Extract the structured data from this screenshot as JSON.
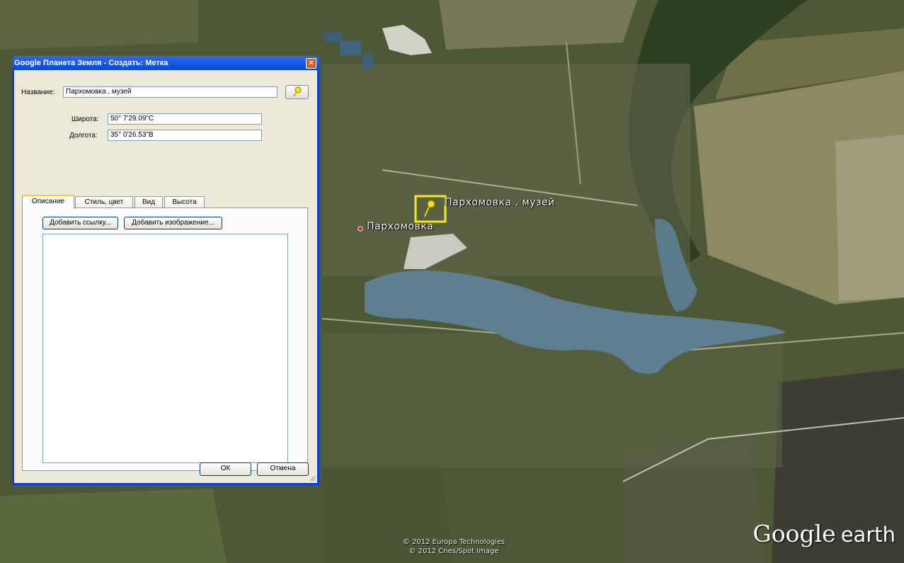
{
  "window": {
    "title": "Google Планета Земля - Создать: Метка"
  },
  "form": {
    "name_label": "Название:",
    "name_value": "Пархомовка , музей",
    "latitude_label": "Широта:",
    "latitude_value": "50° 7'29.09\"С",
    "longitude_label": "Долгота:",
    "longitude_value": "35° 0'26.53\"В"
  },
  "tabs": [
    {
      "label": "Описание",
      "active": true
    },
    {
      "label": "Стиль, цвет"
    },
    {
      "label": "Вид"
    },
    {
      "label": "Высота"
    }
  ],
  "description": {
    "add_link_label": "Добавить ссылку...",
    "add_image_label": "Добавить изображение...",
    "text": ""
  },
  "footer": {
    "ok_label": "ОК",
    "cancel_label": "Отмена"
  },
  "map": {
    "placemark_label": "Пархомовка , музей",
    "village_label": "Пархомовка",
    "copyright_lines": [
      "© 2012 Europa Technologies",
      "© 2012 Cnes/Spot Image"
    ],
    "brand_google": "Google",
    "brand_earth": "earth"
  },
  "icons": [
    "close-icon",
    "pushpin-icon",
    "place-dot-icon",
    "resize-grip-icon"
  ],
  "colors": {
    "titlebar": "#0848d8",
    "dialog_bg": "#ece9d8",
    "pin": "#f2e41c",
    "highlight": "#f5e81a",
    "water": "#5d7f90"
  }
}
